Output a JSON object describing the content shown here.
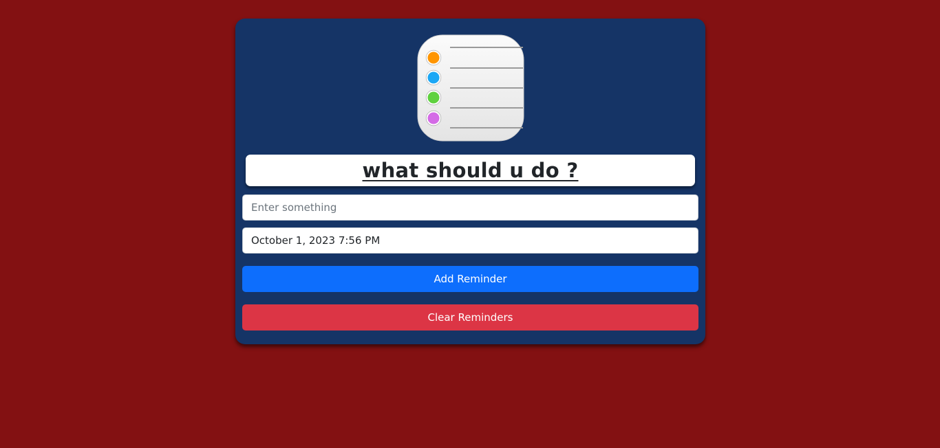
{
  "app_icon": {
    "name": "reminders-list-icon",
    "dot_colors": [
      "#ff9500",
      "#1ba7f5",
      "#5fd13f",
      "#d46be6"
    ]
  },
  "heading": {
    "title": "what should u do ?"
  },
  "form": {
    "reminder_placeholder": "Enter something",
    "reminder_value": "",
    "datetime_value": "October 1, 2023 7:56 PM"
  },
  "buttons": {
    "add_label": "Add Reminder",
    "clear_label": "Clear Reminders"
  },
  "colors": {
    "page_background": "#831112",
    "card_background": "#153466",
    "add_button": "#0d6efd",
    "clear_button": "#dc3545"
  }
}
